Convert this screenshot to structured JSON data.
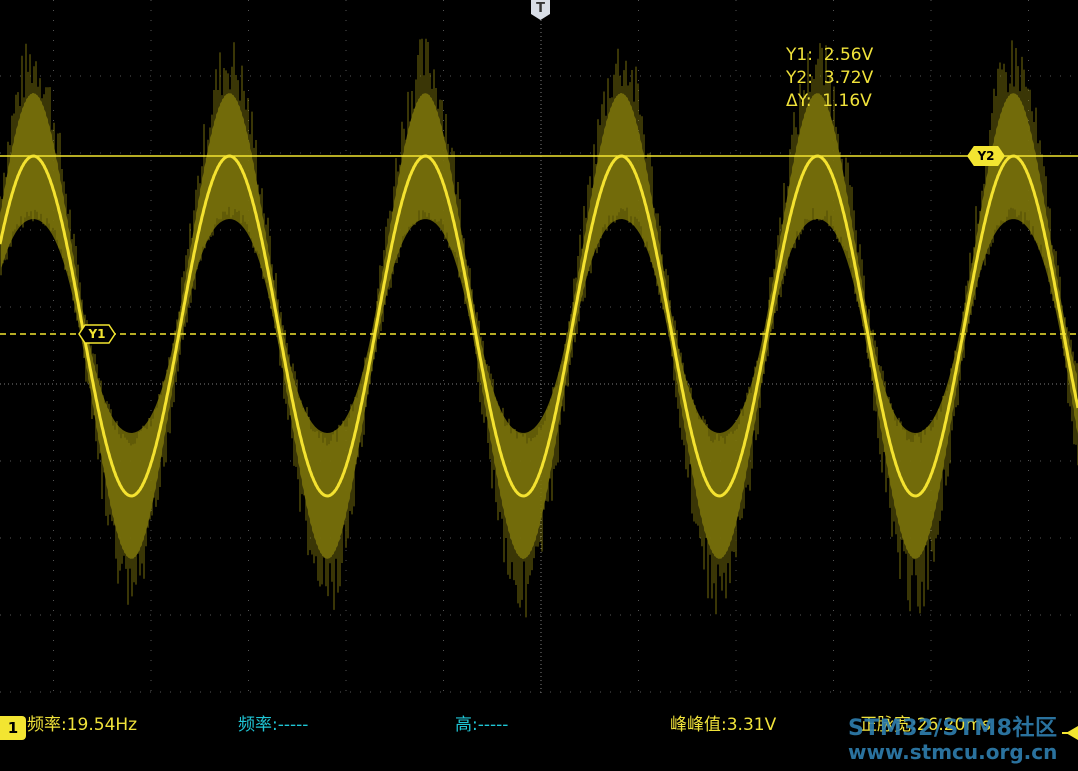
{
  "trigger": {
    "label": "T"
  },
  "cursors": {
    "y1": {
      "tag": "Y1",
      "readout_label": "Y1:",
      "readout_value": "2.56V"
    },
    "y2": {
      "tag": "Y2",
      "readout_label": "Y2:",
      "readout_value": "3.72V"
    },
    "delta": {
      "readout_label": "ΔY:",
      "readout_value": "1.16V"
    }
  },
  "channel": {
    "badge": "1",
    "color": "#f3e531"
  },
  "measurements": [
    {
      "text": "频率:19.54Hz",
      "color": "#f0e23a"
    },
    {
      "text": "频率:-----",
      "color": "#1fc6d6"
    },
    {
      "text": "高:-----",
      "color": "#1fc6d6"
    },
    {
      "text": "峰峰值:3.31V",
      "color": "#f0e23a"
    },
    {
      "text": "正脉宽:26.20ms",
      "color": "#f0e23a"
    }
  ],
  "watermark": {
    "line1": "STM32/STM8社区",
    "line2": "www.stmcu.org.cn"
  },
  "waveform": {
    "cycles_on_screen": 5.5,
    "phase_start": 0.08
  }
}
